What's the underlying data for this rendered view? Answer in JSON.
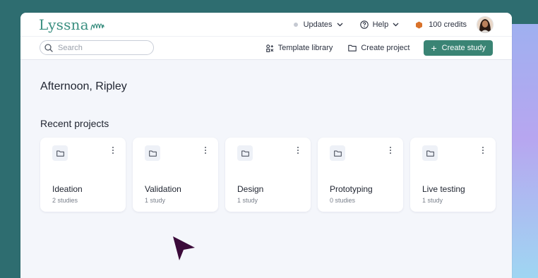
{
  "brand": {
    "name": "Lyssna"
  },
  "nav": {
    "updates_label": "Updates",
    "help_label": "Help",
    "credits_label": "100 credits"
  },
  "toolbar": {
    "search_placeholder": "Search",
    "template_library_label": "Template library",
    "create_project_label": "Create project",
    "create_study_label": "Create study"
  },
  "main": {
    "greeting": "Afternoon, Ripley",
    "recent_projects_title": "Recent projects",
    "projects": [
      {
        "name": "Ideation",
        "count": "2 studies"
      },
      {
        "name": "Validation",
        "count": "1 study"
      },
      {
        "name": "Design",
        "count": "1 study"
      },
      {
        "name": "Prototyping",
        "count": "0 studies"
      },
      {
        "name": "Live testing",
        "count": "1 study"
      }
    ]
  },
  "colors": {
    "background": "#2e6d70",
    "brand": "#3a8f80",
    "primary_button": "#3a8474",
    "credit_icon": "#d9722a",
    "cursor": "#3b0a3a"
  },
  "icons": {
    "logo_mark": "waves-icon",
    "updates": "dot-icon",
    "help": "question-circle-icon",
    "credits": "hexagon-coin-icon",
    "search": "search-icon",
    "template_library": "template-grid-icon",
    "create_project": "folder-icon",
    "create_study": "plus-icon",
    "project_card": "folder-icon",
    "project_menu": "kebab-icon"
  }
}
